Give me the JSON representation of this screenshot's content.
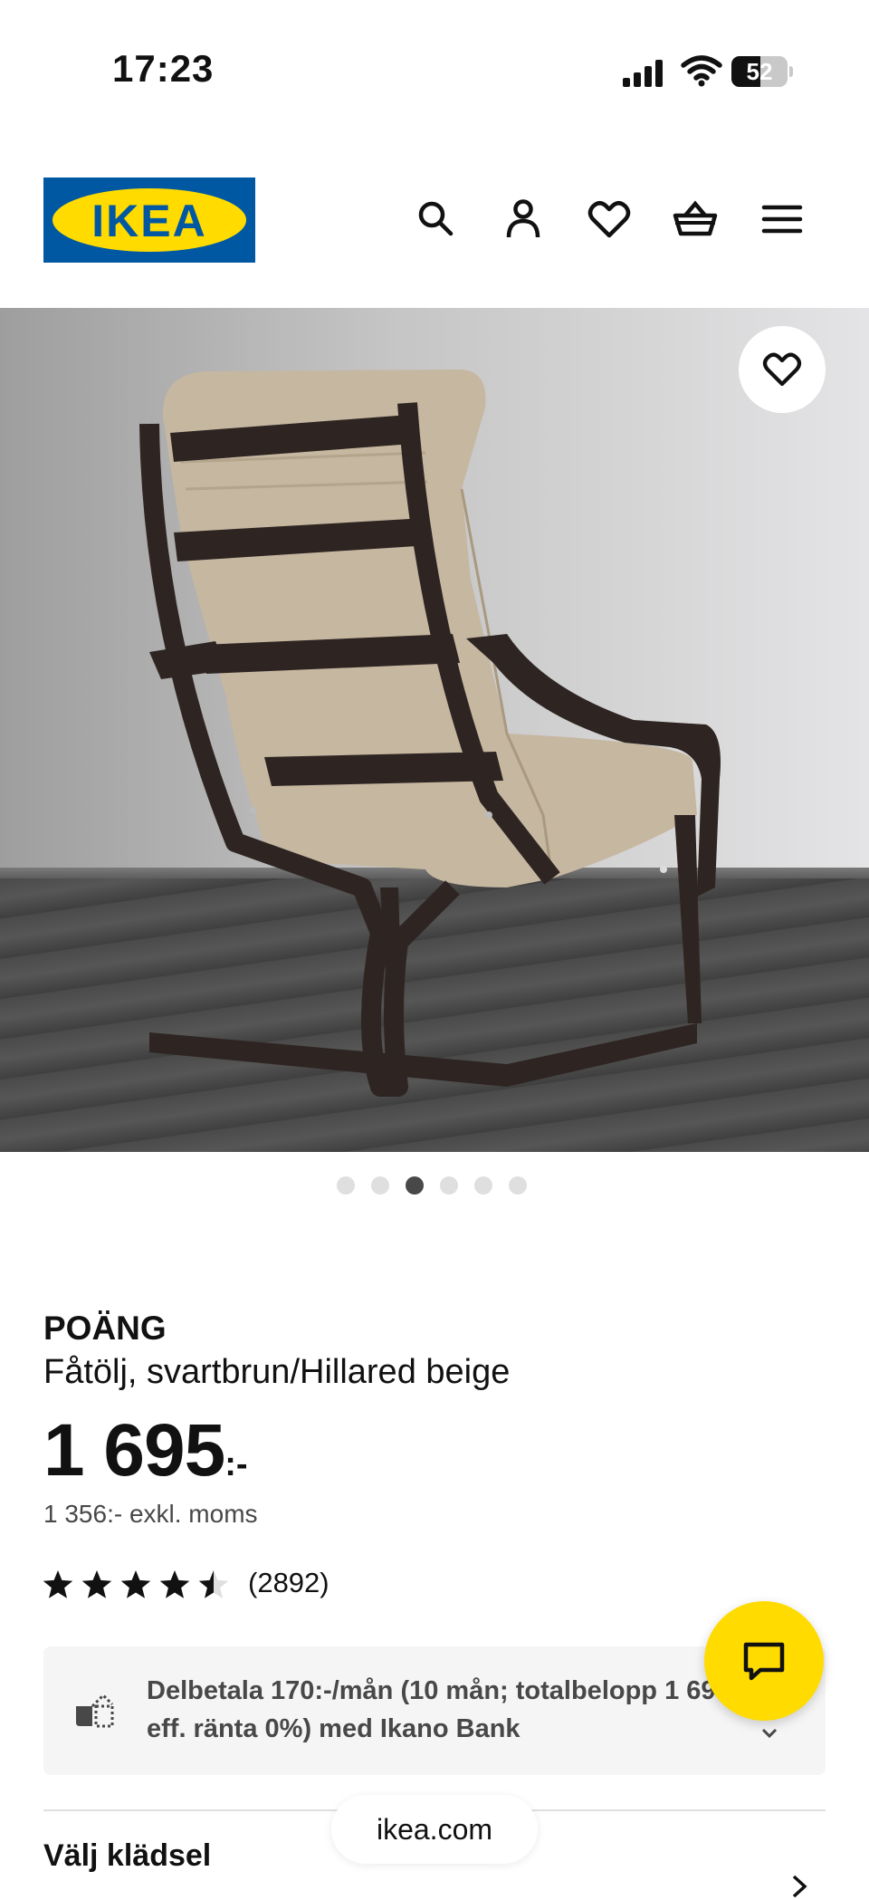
{
  "status_bar": {
    "time": "17:23",
    "battery": "52",
    "battery_level": 0.52
  },
  "header": {
    "logo_text": "IKEA",
    "icons": [
      "search-icon",
      "account-icon",
      "heart-icon",
      "basket-icon",
      "menu-icon"
    ]
  },
  "gallery": {
    "image_count": 6,
    "active_index": 2,
    "favorite_icon": "heart-icon"
  },
  "product": {
    "name": "POÄNG",
    "description": "Fåtölj, svartbrun/Hillared beige",
    "price": "1 695",
    "price_suffix": ":-",
    "price_excl_vat": "1 356:- exkl. moms",
    "rating": 4.5,
    "rating_max": 5,
    "review_count": "(2892)"
  },
  "finance": {
    "text": "Delbetala 170:-/mån (10 mån; totalbelopp 1 695:-; eff. ränta 0%) med Ikano Bank"
  },
  "section": {
    "title": "Välj klädsel"
  },
  "browser": {
    "url": "ikea.com"
  },
  "colors": {
    "brand_blue": "#0058a3",
    "brand_yellow": "#ffdb00",
    "text": "#111111",
    "muted": "#484848"
  }
}
